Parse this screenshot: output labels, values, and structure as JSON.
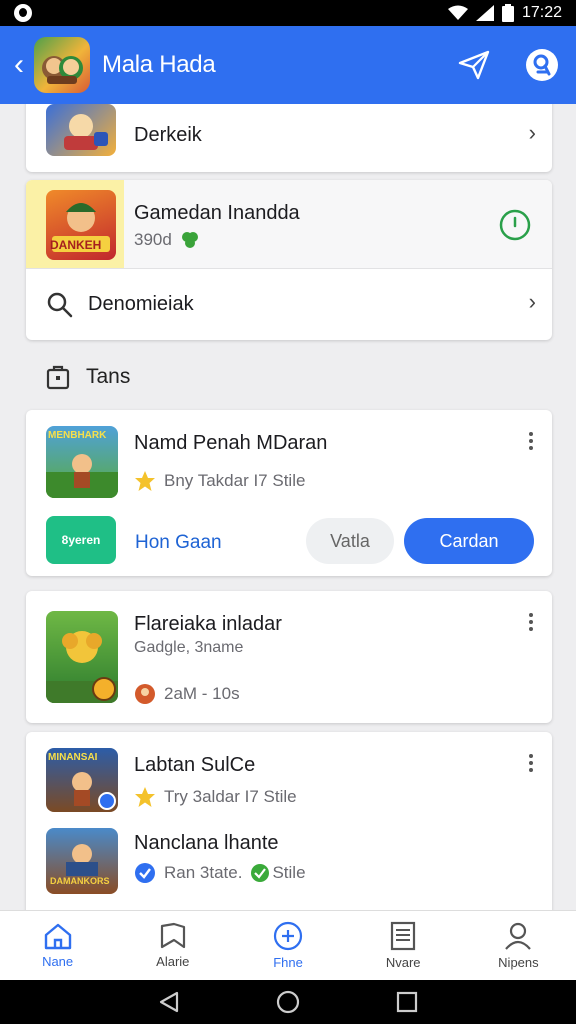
{
  "status_bar": {
    "time": "17:22",
    "left_icon": "app-notification-icon",
    "icons": [
      "wifi-icon",
      "signal-icon",
      "battery-icon"
    ]
  },
  "header": {
    "title": "Mala Hada",
    "back_icon": "chevron-left-icon",
    "actions": [
      "send-icon",
      "profile-search-icon"
    ],
    "color": "#2f6ff0"
  },
  "top_list": [
    {
      "title": "Derkeik"
    },
    {
      "title": "Gamedan Inandda",
      "subtitle": "390d",
      "badge_icon": "clover-icon",
      "action_icon": "power-icon",
      "thumb_text": "DANKEH"
    },
    {
      "title": "Denomieiak",
      "icon": "search-icon"
    }
  ],
  "section": {
    "title": "Tans",
    "icon": "briefcase-icon"
  },
  "cards": [
    {
      "title": "Namd Penah MDaran",
      "subtitle": "Bny Takdar I7 Stile",
      "thumb_text": "MENBHARK",
      "app_thumb_text": "8yeren",
      "link": "Hon Gaan",
      "secondary_button": "Vatla",
      "primary_button": "Cardan"
    },
    {
      "title": "Flareiaka inladar",
      "subtitle": "Gadgle, 3name",
      "meta": "2aM - 10s"
    },
    {
      "title": "Labtan SulCe",
      "subtitle": "Try 3aldar I7 Stile",
      "thumb_text": "MINANSAI"
    },
    {
      "title": "Nanclana lhante",
      "subtitle_left": "Ran 3tate.",
      "subtitle_right": "Stile",
      "thumb_text": "DAMANKORS"
    }
  ],
  "bottom_nav": [
    {
      "label": "Nane",
      "icon": "home-icon",
      "active": true
    },
    {
      "label": "Alarie",
      "icon": "bookmark-icon",
      "active": false
    },
    {
      "label": "Fhne",
      "icon": "plus-circle-icon",
      "active": true
    },
    {
      "label": "Nvare",
      "icon": "document-icon",
      "active": false
    },
    {
      "label": "Nipens",
      "icon": "person-icon",
      "active": false
    }
  ]
}
